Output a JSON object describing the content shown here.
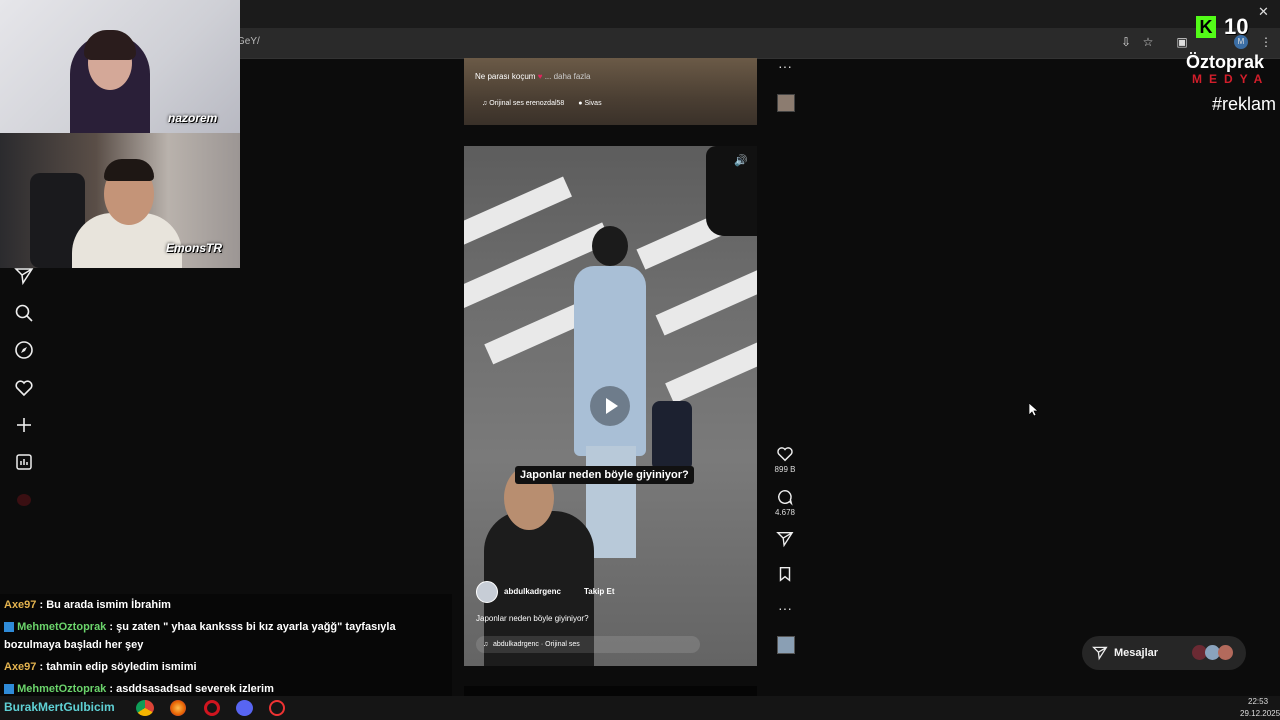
{
  "browser": {
    "url_fragment": "GeY/"
  },
  "overlay": {
    "kick_count": "10",
    "brand_name": "Öztoprak",
    "brand_sub": "MEDYA",
    "hashtag": "#reklam",
    "cam1_label": "nazorem",
    "cam2_label": "EmonsTR"
  },
  "feed": {
    "prev_post": {
      "caption": "Ne parası koçum",
      "more": "... daha fazla",
      "audio": "Orijinal ses",
      "audio_user": "erenozdal58",
      "location": "Sivas"
    },
    "video": {
      "overlay_text": "Japonlar neden böyle giyiniyor?",
      "username": "abdulkadrgenc",
      "follow": "Takip Et",
      "description": "Japonlar neden böyle giyiniyor?",
      "audio": "abdulkadrgenc · Orijinal ses"
    },
    "actions": {
      "likes": "899 B",
      "comments": "4.678"
    }
  },
  "chat": [
    {
      "user": "Axe97",
      "text": ": Bu arada ismim İbrahim"
    },
    {
      "user": "MehmetOztoprak",
      "text": ": şu zaten \" yhaa kanksss bi kız ayarla yağğ\" tayfasıyla bozulmaya başladı her şey"
    },
    {
      "user": "Axe97",
      "text": ": tahmin edip söyledim ismimi"
    },
    {
      "user": "MehmetOztoprak",
      "text": ": asddsasadsad severek izlerim"
    },
    {
      "user": "BurakMertGulbicim",
      "text": ""
    }
  ],
  "messages": {
    "label": "Mesajlar"
  },
  "clock": {
    "time": "22:53",
    "date": "29.12.2025"
  },
  "colors": {
    "kick_green": "#53fc18",
    "medya_red": "#d21e2b"
  }
}
